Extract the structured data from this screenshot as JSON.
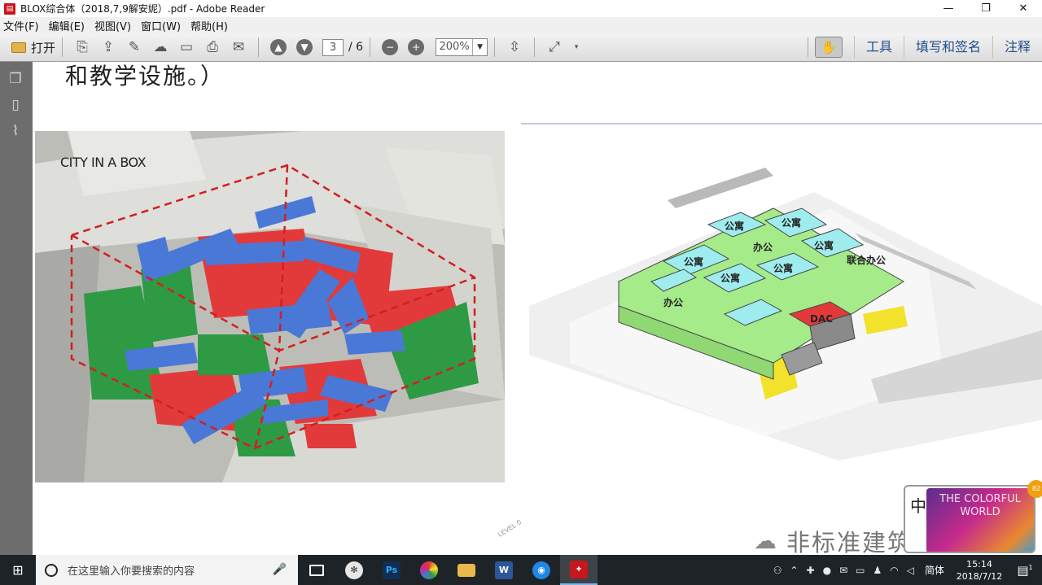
{
  "window": {
    "title": "BLOX综合体（2018,7,9解安妮）.pdf - Adobe Reader",
    "app_icon": "pdf-icon",
    "controls": [
      "—",
      "❐",
      "✕"
    ]
  },
  "menubar": {
    "items": [
      "文件(F)",
      "编辑(E)",
      "视图(V)",
      "窗口(W)",
      "帮助(H)"
    ]
  },
  "toolbar": {
    "open_label": "打开",
    "page_current": "3",
    "page_total": "/ 6",
    "zoom": "200%",
    "links": [
      "工具",
      "填写和签名",
      "注释"
    ]
  },
  "sidebar": {
    "icons": [
      "pages-icon",
      "bookmark-icon",
      "attachment-icon"
    ]
  },
  "document": {
    "heading": "和教学设施。）",
    "photo_caption": "CITY IN A BOX",
    "diagram_labels": [
      "公寓",
      "公寓",
      "办公",
      "公寓",
      "公寓",
      "公寓",
      "公寓",
      "联合办公",
      "DAC",
      "办公"
    ],
    "level_label": "LEVEL 0"
  },
  "watermark": {
    "text": "非标准建筑工作室",
    "thumb_zh": "中",
    "thumb_text": "THE COLORFUL WORLD",
    "badge": "82"
  },
  "taskbar": {
    "search_placeholder": "在这里输入你要搜索的内容",
    "ime": "简体",
    "time": "15:14",
    "date": "2018/7/12",
    "notification_count": "1"
  },
  "colors": {
    "sidebar": "#6d6d6d",
    "taskbar": "#1e2327",
    "toolbar_link": "#1f4e8c",
    "model_red": "#e23a3a",
    "model_blue": "#4a78d6",
    "model_green": "#2e9a44",
    "diagram_cyan": "#9fecef",
    "diagram_green": "#a6eb8a",
    "diagram_yellow": "#f2e22b"
  }
}
